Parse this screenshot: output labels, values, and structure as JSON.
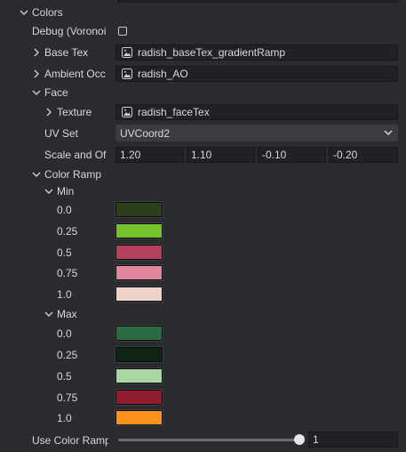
{
  "colors_section": {
    "label": "Colors"
  },
  "debug": {
    "label": "Debug (Voronoi",
    "checked": false
  },
  "base_tex": {
    "label": "Base Tex",
    "value": "radish_baseTex_gradientRamp"
  },
  "ambient_occ": {
    "label": "Ambient Occ",
    "value": "radish_AO"
  },
  "face_section": {
    "label": "Face"
  },
  "texture": {
    "label": "Texture",
    "value": "radish_faceTex"
  },
  "uv_set": {
    "label": "UV Set",
    "value": "UVCoord2"
  },
  "scale_offset": {
    "label": "Scale and Of",
    "values": [
      "1.20",
      "1.10",
      "-0.10",
      "-0.20"
    ]
  },
  "color_ramp": {
    "label": "Color Ramp"
  },
  "min": {
    "label": "Min",
    "stops": [
      {
        "label": "0.0",
        "color": "#2b3d1b"
      },
      {
        "label": "0.25",
        "color": "#74c32a"
      },
      {
        "label": "0.5",
        "color": "#b4405e"
      },
      {
        "label": "0.75",
        "color": "#e0879f"
      },
      {
        "label": "1.0",
        "color": "#ecd2c8"
      }
    ]
  },
  "max": {
    "label": "Max",
    "stops": [
      {
        "label": "0.0",
        "color": "#2a6b43"
      },
      {
        "label": "0.25",
        "color": "#0f2414"
      },
      {
        "label": "0.5",
        "color": "#a9d6a5"
      },
      {
        "label": "0.75",
        "color": "#911c32"
      },
      {
        "label": "1.0",
        "color": "#ff921c"
      }
    ]
  },
  "use_color_ramp": {
    "label": "Use Color Ramp",
    "value": "1",
    "level": 1.0
  }
}
